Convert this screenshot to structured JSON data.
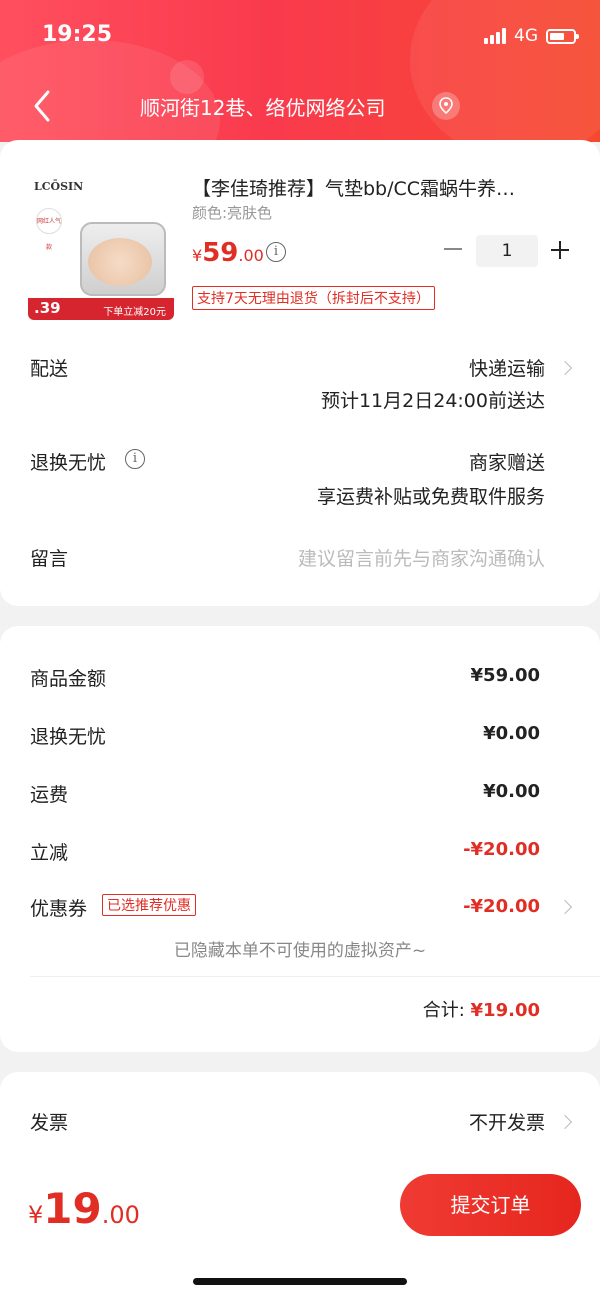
{
  "status_bar": {
    "time": "19:25",
    "network": "4G"
  },
  "header": {
    "address": "顺河街12巷、络优网络公司"
  },
  "product": {
    "image": {
      "brand": "LCŌSIN",
      "badge_text": "网红人气款",
      "strip_price": ".39",
      "strip_text": "下单立减20元"
    },
    "title": "【李佳琦推荐】气垫bb/CC霜蜗牛养…",
    "sku": "颜色:亮肤色",
    "price_symbol": "¥",
    "price_int": "59",
    "price_dec": ".00",
    "quantity": "1",
    "return_tag": "支持7天无理由退货（拆封后不支持）"
  },
  "delivery": {
    "label": "配送",
    "method": "快递运输",
    "eta": "预计11月2日24:00前送达"
  },
  "exchange": {
    "label": "退换无忧",
    "value": "商家赠送",
    "detail": "享运费补贴或免费取件服务"
  },
  "message": {
    "label": "留言",
    "placeholder": "建议留言前先与商家沟通确认"
  },
  "summary": {
    "goods_label": "商品金额",
    "goods_value": "¥59.00",
    "exchange_label": "退换无忧",
    "exchange_value": "¥0.00",
    "shipping_label": "运费",
    "shipping_value": "¥0.00",
    "discount_label": "立减",
    "discount_value": "-¥20.00",
    "coupon_label": "优惠券",
    "coupon_tag": "已选推荐优惠",
    "coupon_value": "-¥20.00",
    "hidden_note": "已隐藏本单不可使用的虚拟资产~",
    "total_label": "合计:",
    "total_value": "¥19.00"
  },
  "invoice": {
    "label": "发票",
    "value": "不开发票"
  },
  "bottom": {
    "price_symbol": "¥",
    "price_int": "19",
    "price_dec": ".00",
    "submit_label": "提交订单"
  },
  "colors": {
    "accent": "#e02e24",
    "header_start": "#ff4f5e",
    "header_end": "#f7482f"
  }
}
